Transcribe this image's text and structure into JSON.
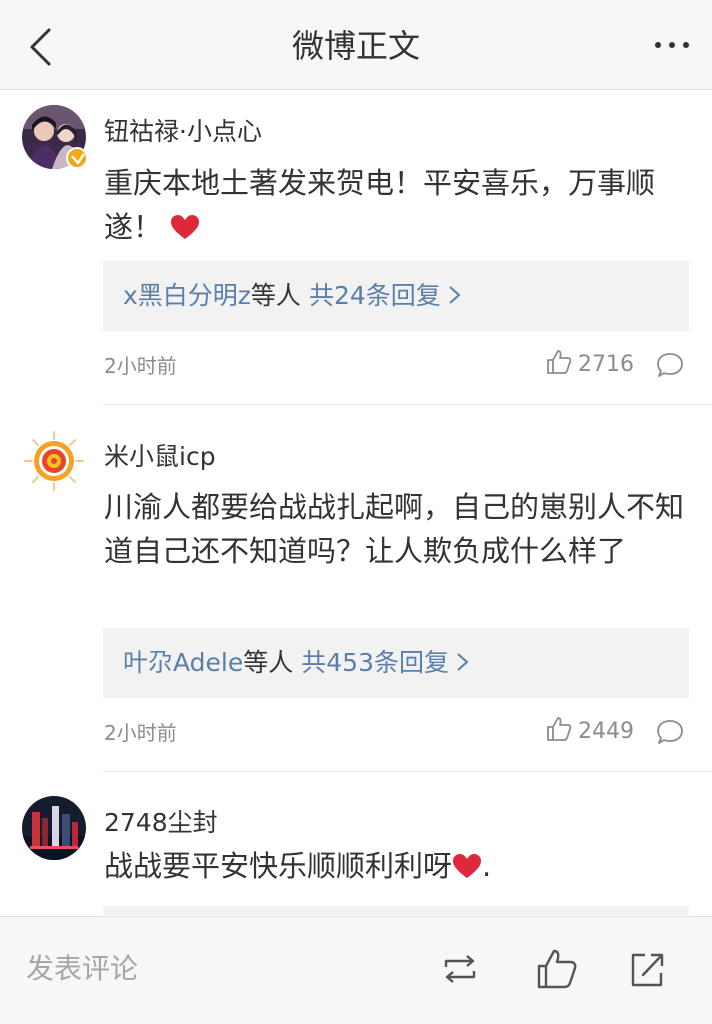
{
  "header": {
    "title": "微博正文",
    "back_icon": "back-chevron-icon",
    "more_icon": "more-dots-icon"
  },
  "comments": [
    {
      "user": "钮祜禄·小点心",
      "verified": true,
      "text": "重庆本地土著发来贺电！平安喜乐，万事顺遂！",
      "emoji": "heart-emoji",
      "replies": {
        "users": "x黑白分明z",
        "suffix": "等人",
        "count": "共24条回复"
      },
      "time": "2小时前",
      "likes": "2716"
    },
    {
      "user": "米小鼠icp",
      "verified": false,
      "text": "川渝人都要给战战扎起啊，自己的崽别人不知道自己还不知道吗？让人欺负成什么样了",
      "replies": {
        "users": "叶尕Adele",
        "suffix": "等人",
        "count": "共453条回复"
      },
      "time": "2小时前",
      "likes": "2449"
    },
    {
      "user": "2748尘封",
      "verified": false,
      "text_before": "战战要平安快乐顺顺利利呀",
      "text_after": ".",
      "emoji": "heart-emoji"
    }
  ],
  "bottom_bar": {
    "comment_placeholder": "发表评论",
    "icons": [
      "repost-icon",
      "like-icon",
      "share-icon"
    ]
  },
  "colors": {
    "link": "#5b7fab",
    "heart": "#e0283c",
    "verified_badge": "#f0a818",
    "secondary_text": "#8c8c8c"
  }
}
